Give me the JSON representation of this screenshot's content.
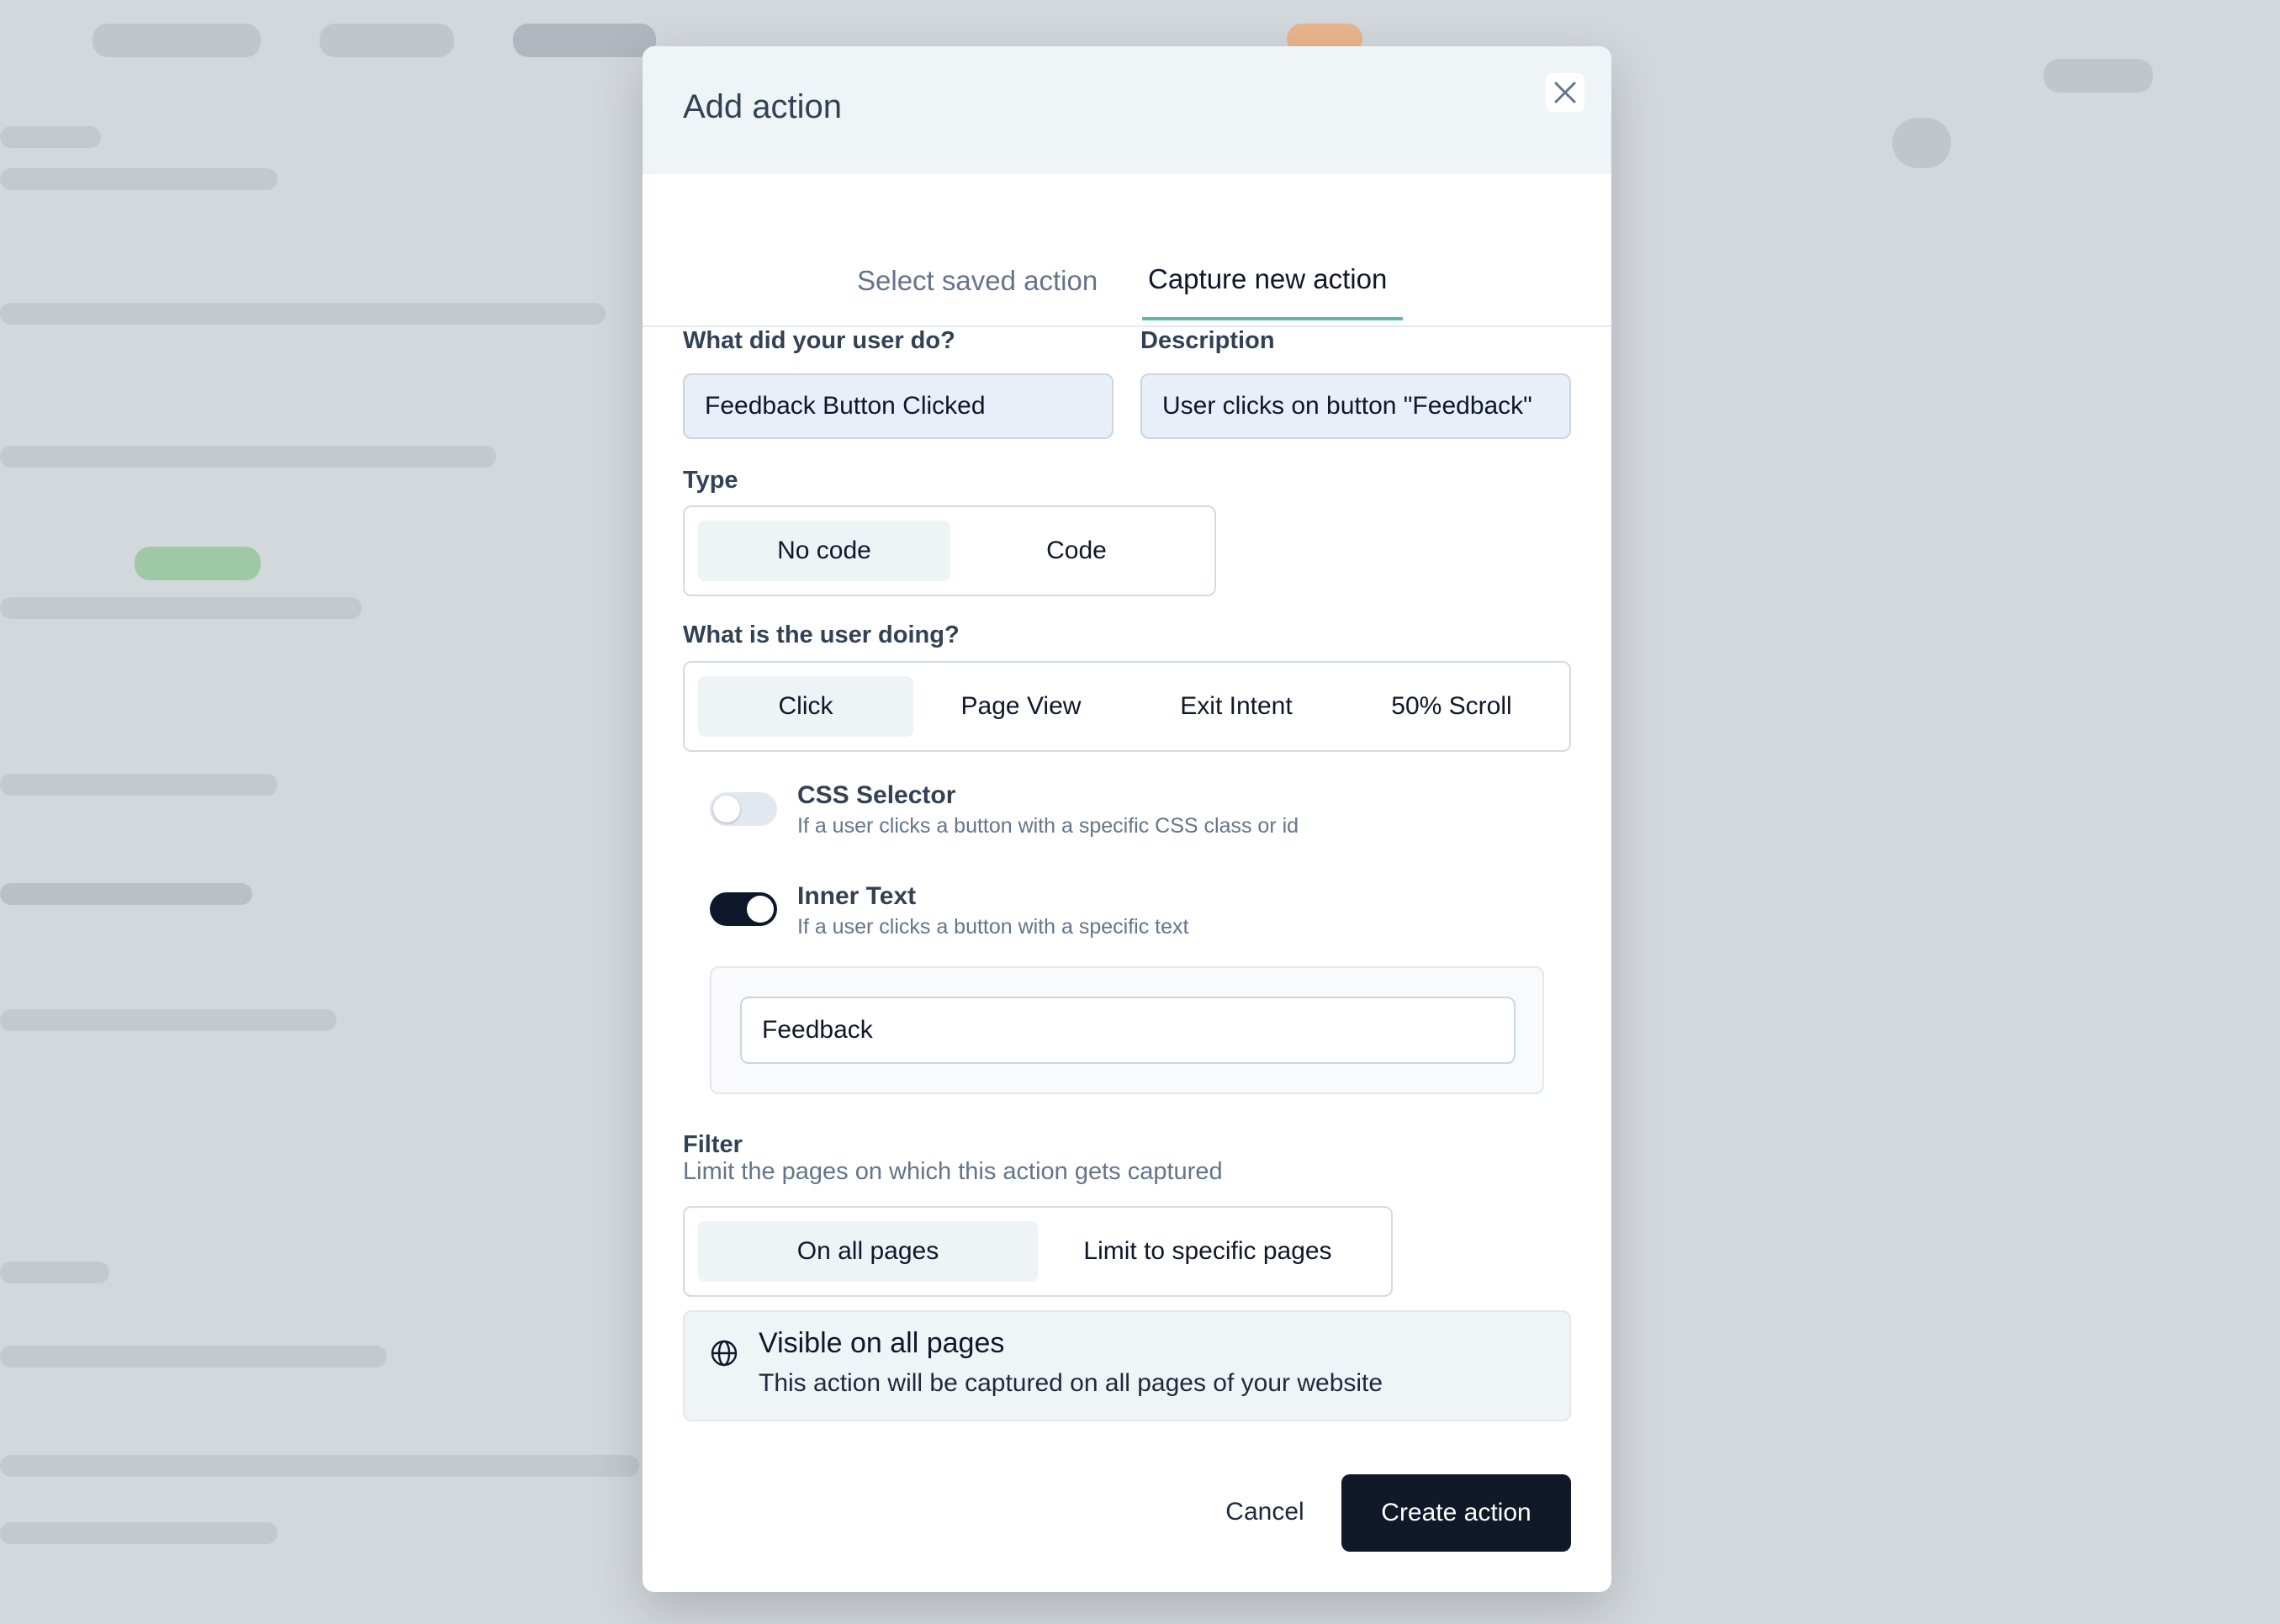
{
  "modal": {
    "title": "Add action",
    "tabs": [
      {
        "label": "Select saved action",
        "active": false
      },
      {
        "label": "Capture new action",
        "active": true
      }
    ]
  },
  "form": {
    "user_action": {
      "label": "What did your user do?",
      "value": "Feedback Button Clicked"
    },
    "description": {
      "label": "Description",
      "value": "User clicks on button \"Feedback\""
    },
    "type": {
      "label": "Type",
      "options": [
        "No code",
        "Code"
      ],
      "selected": "No code"
    },
    "user_doing": {
      "label": "What is the user doing?",
      "options": [
        "Click",
        "Page View",
        "Exit Intent",
        "50% Scroll"
      ],
      "selected": "Click"
    },
    "css_selector": {
      "title": "CSS Selector",
      "description": "If a user clicks a button with a specific CSS class or id",
      "enabled": false
    },
    "inner_text": {
      "title": "Inner Text",
      "description": "If a user clicks a button with a specific text",
      "enabled": true,
      "value": "Feedback"
    },
    "filter": {
      "label": "Filter",
      "sublabel": "Limit the pages on which this action gets captured",
      "options": [
        "On all pages",
        "Limit to specific pages"
      ],
      "selected": "On all pages"
    },
    "info": {
      "title": "Visible on all pages",
      "description": "This action will be captured on all pages of your website"
    }
  },
  "footer": {
    "cancel_label": "Cancel",
    "create_label": "Create action"
  },
  "colors": {
    "accent": "#5fb8ae",
    "primary_button": "#111827",
    "header_bg": "#eff4f6"
  },
  "icons": {
    "close": "close-icon",
    "globe": "globe-icon"
  }
}
